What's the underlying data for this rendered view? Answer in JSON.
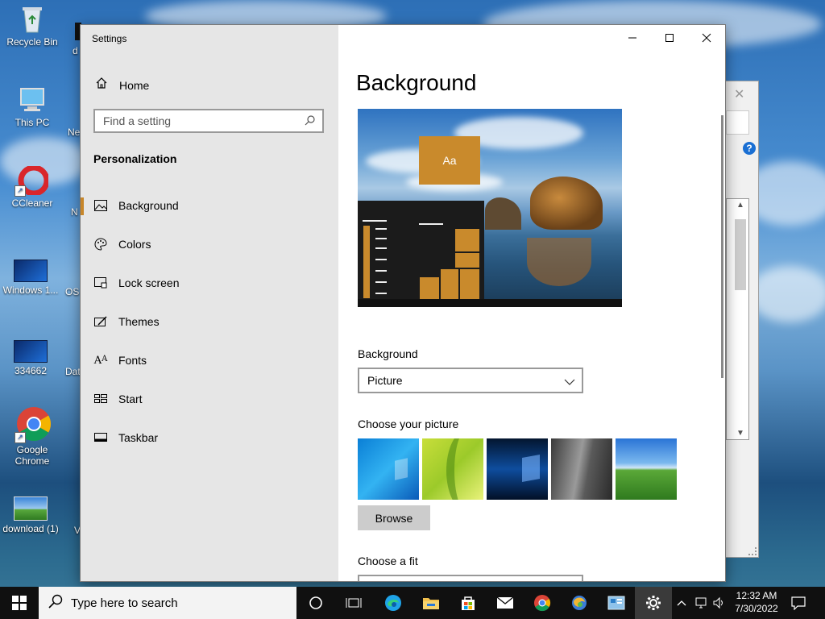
{
  "desktop": {
    "icons": [
      {
        "label": "Recycle Bin"
      },
      {
        "label": "This PC"
      },
      {
        "label": "CCleaner"
      },
      {
        "label": "Windows 1..."
      },
      {
        "label": "334662"
      },
      {
        "label": "Google Chrome"
      },
      {
        "label": "download (1)"
      }
    ],
    "partial_labels": [
      "d",
      "Ne",
      "N",
      "OS",
      "Dat",
      "",
      "V"
    ]
  },
  "settings": {
    "window_title": "Settings",
    "controls": {
      "minimize": "—",
      "maximize": "☐",
      "close": "✕"
    },
    "home_label": "Home",
    "search_placeholder": "Find a setting",
    "section_title": "Personalization",
    "nav_items": [
      {
        "label": "Background",
        "icon": "picture-icon",
        "active": true
      },
      {
        "label": "Colors",
        "icon": "palette-icon",
        "active": false
      },
      {
        "label": "Lock screen",
        "icon": "lock-screen-icon",
        "active": false
      },
      {
        "label": "Themes",
        "icon": "themes-icon",
        "active": false
      },
      {
        "label": "Fonts",
        "icon": "fonts-icon",
        "active": false
      },
      {
        "label": "Start",
        "icon": "start-icon",
        "active": false
      },
      {
        "label": "Taskbar",
        "icon": "taskbar-icon",
        "active": false
      }
    ],
    "page_title": "Background",
    "preview_tile_text": "Aa",
    "background_label": "Background",
    "background_value": "Picture",
    "choose_picture_label": "Choose your picture",
    "browse_label": "Browse",
    "choose_fit_label": "Choose a fit",
    "accent_color": "#c98a2c"
  },
  "taskbar": {
    "search_placeholder": "Type here to search",
    "time": "12:32 AM",
    "date": "7/30/2022"
  }
}
